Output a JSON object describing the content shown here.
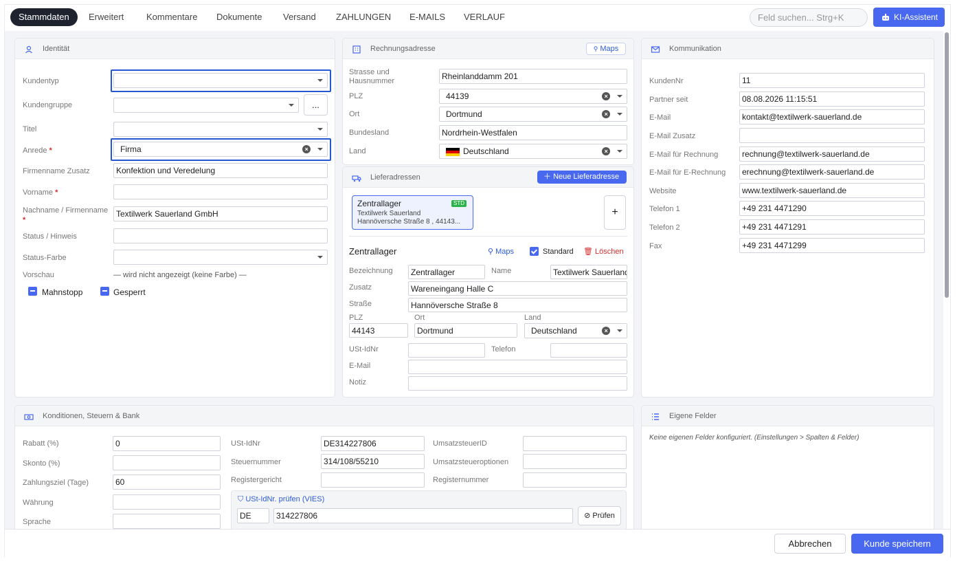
{
  "tabs": [
    {
      "label": "Stammdaten",
      "active": true
    },
    {
      "label": "Erweitert"
    },
    {
      "label": "Kommentare"
    },
    {
      "label": "Dokumente"
    },
    {
      "label": "Versand"
    },
    {
      "label": "ZAHLUNGEN"
    },
    {
      "label": "E-MAILS"
    },
    {
      "label": "VERLAUF"
    }
  ],
  "search": {
    "placeholder": "Feld suchen... Strg+K"
  },
  "ki": {
    "label": "KI-Assistent"
  },
  "ident": {
    "title": "Identität",
    "kundentyp": {
      "label": "Kundentyp",
      "value": ""
    },
    "kundengruppe": {
      "label": "Kundengruppe",
      "value": "",
      "more": "..."
    },
    "titel": {
      "label": "Titel",
      "value": ""
    },
    "anrede": {
      "label": "Anrede",
      "value": "Firma"
    },
    "firmenzusatz": {
      "label": "Firmenname Zusatz",
      "value": "Konfektion und Veredelung"
    },
    "vorname": {
      "label": "Vorname",
      "value": ""
    },
    "nachname": {
      "label": "Nachname / Firmenname",
      "value": "Textilwerk Sauerland GmbH"
    },
    "status": {
      "label": "Status / Hinweis",
      "value": ""
    },
    "statusfarbe": {
      "label": "Status-Farbe",
      "value": ""
    },
    "vorschau": {
      "label": "Vorschau",
      "value": "— wird nicht angezeigt (keine Farbe) —"
    },
    "mahnstopp": "Mahnstopp",
    "gesperrt": "Gesperrt"
  },
  "rechnung": {
    "title": "Rechnungsadresse",
    "maps": "Maps",
    "strasse": {
      "label1": "Strasse und",
      "label2": "Hausnummer",
      "value": "Rheinlanddamm 201"
    },
    "plz": {
      "label": "PLZ",
      "value": "44139"
    },
    "ort": {
      "label": "Ort",
      "value": "Dortmund"
    },
    "bundesland": {
      "label": "Bundesland",
      "value": "Nordrhein-Westfalen"
    },
    "land": {
      "label": "Land",
      "value": "Deutschland"
    }
  },
  "liefer": {
    "title": "Lieferadressen",
    "new": "Neue Lieferadresse",
    "chip": {
      "name": "Zentrallager",
      "badge": "STD",
      "line1": "Textilwerk Sauerland",
      "line2": "Hannöversche Straße 8 ,  44143..."
    },
    "add": "+",
    "detail_title": "Zentrallager",
    "maps": "Maps",
    "standard": "Standard",
    "loeschen": "Löschen",
    "bezeichnung": {
      "label": "Bezeichnung",
      "value": "Zentrallager"
    },
    "name": {
      "label": "Name",
      "value": "Textilwerk Sauerland"
    },
    "zusatz": {
      "label": "Zusatz",
      "value": "Wareneingang Halle C"
    },
    "strasse": {
      "label": "Straße",
      "value": "Hannöversche Straße 8"
    },
    "plz": {
      "label": "PLZ",
      "value": "44143"
    },
    "ort": {
      "label": "Ort",
      "value": "Dortmund"
    },
    "land": {
      "label": "Land",
      "value": "Deutschland"
    },
    "ust": {
      "label": "USt-IdNr",
      "value": ""
    },
    "telefon": {
      "label": "Telefon",
      "value": ""
    },
    "email": {
      "label": "E-Mail",
      "value": ""
    },
    "notiz": {
      "label": "Notiz",
      "value": ""
    }
  },
  "komm": {
    "title": "Kommunikation",
    "fields": [
      {
        "label": "KundenNr",
        "value": "11"
      },
      {
        "label": "Partner seit",
        "value": "08.08.2026 11:15:51"
      },
      {
        "label": "E-Mail",
        "value": "kontakt@textilwerk-sauerland.de"
      },
      {
        "label": "E-Mail Zusatz",
        "value": ""
      },
      {
        "label": "E-Mail für Rechnung",
        "value": "rechnung@textilwerk-sauerland.de"
      },
      {
        "label": "E-Mail für E-Rechnung",
        "value": "erechnung@textilwerk-sauerland.de"
      },
      {
        "label": "Website",
        "value": "www.textilwerk-sauerland.de"
      },
      {
        "label": "Telefon 1",
        "value": "+49 231 4471290"
      },
      {
        "label": "Telefon 2",
        "value": "+49 231 4471291"
      },
      {
        "label": "Fax",
        "value": "+49 231 4471299"
      }
    ]
  },
  "kond": {
    "title": "Konditionen, Steuern & Bank",
    "rabatt": {
      "label": "Rabatt (%)",
      "value": "0"
    },
    "skonto": {
      "label": "Skonto (%)",
      "value": ""
    },
    "zahlungsziel": {
      "label": "Zahlungsziel (Tage)",
      "value": "60"
    },
    "waehrung": {
      "label": "Währung",
      "value": ""
    },
    "sprache": {
      "label": "Sprache",
      "value": ""
    },
    "ustid": {
      "label": "USt-IdNr",
      "value": "DE314227806"
    },
    "steuernr": {
      "label": "Steuernummer",
      "value": "314/108/55210"
    },
    "registergericht": {
      "label": "Registergericht",
      "value": ""
    },
    "umsatzsteuerid": {
      "label": "UmsatzsteuerID",
      "value": ""
    },
    "umsatzsteueroptionen": {
      "label": "Umsatzsteueroptionen",
      "value": ""
    },
    "registernummer": {
      "label": "Registernummer",
      "value": ""
    },
    "vies": {
      "title": "USt-IdNr. prüfen (VIES)",
      "country": "DE",
      "number": "314227806",
      "btn": "Prüfen"
    }
  },
  "eigene": {
    "title": "Eigene Felder",
    "empty": "Keine eigenen Felder konfiguriert. (Einstellungen > Spalten & Felder)"
  },
  "footer": {
    "cancel": "Abbrechen",
    "save": "Kunde speichern"
  },
  "colors": {
    "accent": "#4868f0",
    "active_tab": "#1f2330",
    "focus": "#2558d0",
    "std_badge": "#2bb34a",
    "delete": "#d32f2f"
  }
}
